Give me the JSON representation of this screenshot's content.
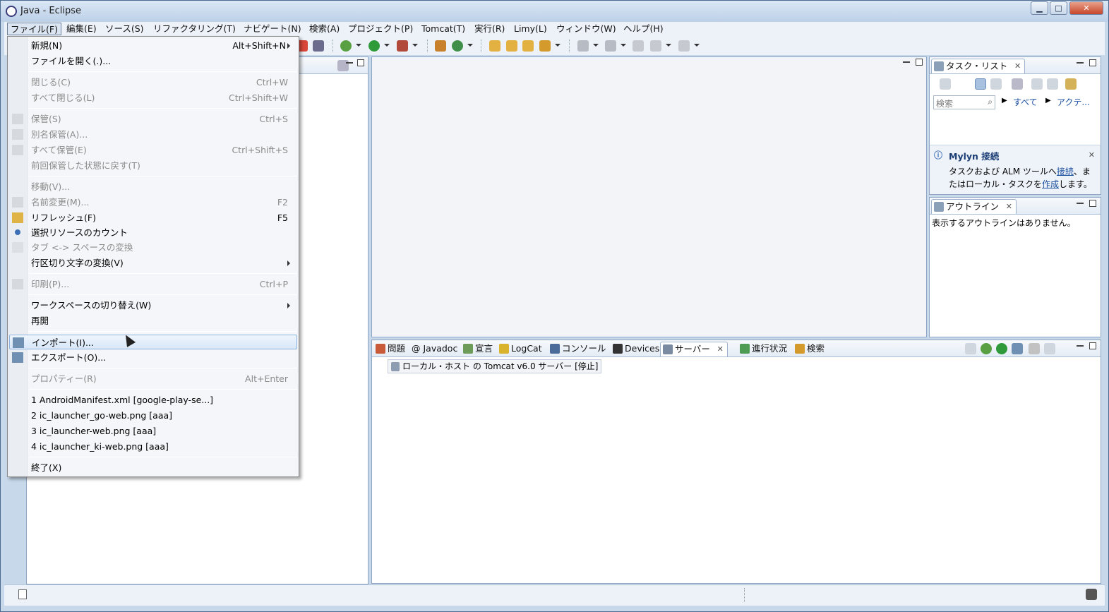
{
  "window": {
    "title": "Java - Eclipse",
    "controls": [
      "minimize",
      "maximize",
      "close"
    ]
  },
  "menubar": [
    "ファイル(F)",
    "編集(E)",
    "ソース(S)",
    "リファクタリング(T)",
    "ナビゲート(N)",
    "検索(A)",
    "プロジェクト(P)",
    "Tomcat(T)",
    "実行(R)",
    "Limy(L)",
    "ウィンドウ(W)",
    "ヘルプ(H)"
  ],
  "file_menu": {
    "items": [
      {
        "label": "新規(N)",
        "shortcut": "Alt+Shift+N",
        "submenu": true,
        "disabled": false
      },
      {
        "label": "ファイルを開く(.)...",
        "shortcut": "",
        "disabled": false
      },
      {
        "label": "閉じる(C)",
        "shortcut": "Ctrl+W",
        "disabled": true
      },
      {
        "label": "すべて閉じる(L)",
        "shortcut": "Ctrl+Shift+W",
        "disabled": true
      },
      {
        "label": "保管(S)",
        "shortcut": "Ctrl+S",
        "disabled": true
      },
      {
        "label": "別名保管(A)...",
        "shortcut": "",
        "disabled": true
      },
      {
        "label": "すべて保管(E)",
        "shortcut": "Ctrl+Shift+S",
        "disabled": true
      },
      {
        "label": "前回保管した状態に戻す(T)",
        "shortcut": "",
        "disabled": true
      },
      {
        "label": "移動(V)...",
        "shortcut": "",
        "disabled": true
      },
      {
        "label": "名前変更(M)...",
        "shortcut": "F2",
        "disabled": true
      },
      {
        "label": "リフレッシュ(F)",
        "shortcut": "F5",
        "disabled": false
      },
      {
        "label": "選択リソースのカウント",
        "shortcut": "",
        "disabled": false
      },
      {
        "label": "タブ <-> スペースの変換",
        "shortcut": "",
        "disabled": true
      },
      {
        "label": "行区切り文字の変換(V)",
        "shortcut": "",
        "submenu": true,
        "disabled": false
      },
      {
        "label": "印刷(P)...",
        "shortcut": "Ctrl+P",
        "disabled": true
      },
      {
        "label": "ワークスペースの切り替え(W)",
        "shortcut": "",
        "submenu": true,
        "disabled": false
      },
      {
        "label": "再開",
        "shortcut": "",
        "disabled": false
      },
      {
        "label": "インポート(I)...",
        "shortcut": "",
        "disabled": false,
        "highlighted": true
      },
      {
        "label": "エクスポート(O)...",
        "shortcut": "",
        "disabled": false
      },
      {
        "label": "プロパティー(R)",
        "shortcut": "Alt+Enter",
        "disabled": true
      },
      {
        "label": "1 AndroidManifest.xml  [google-play-se...]",
        "shortcut": "",
        "disabled": false
      },
      {
        "label": "2 ic_launcher_go-web.png  [aaa]",
        "shortcut": "",
        "disabled": false
      },
      {
        "label": "3 ic_launcher-web.png  [aaa]",
        "shortcut": "",
        "disabled": false
      },
      {
        "label": "4 ic_launcher_ki-web.png  [aaa]",
        "shortcut": "",
        "disabled": false
      },
      {
        "label": "終了(X)",
        "shortcut": "",
        "disabled": false
      }
    ]
  },
  "task_list": {
    "tab": "タスク・リスト",
    "search_placeholder": "検索",
    "filter_all": "すべて",
    "filter_active": "アクテ...",
    "mylyn_title": "Mylyn 接続",
    "mylyn_text_1": "タスクおよび ALM ツールへ",
    "mylyn_link_connect": "接続",
    "mylyn_text_2": "、ま",
    "mylyn_text_3": "たはローカル・タスクを",
    "mylyn_link_create": "作成",
    "mylyn_text_4": "します。"
  },
  "outline": {
    "tab": "アウトライン",
    "empty_message": "表示するアウトラインはありません。"
  },
  "bottom_tabs": [
    "問題",
    "@ Javadoc",
    "宣言",
    "LogCat",
    "コンソール",
    "Devices",
    "サーバー",
    "進行状況",
    "検索"
  ],
  "servers": {
    "entry": "ローカル・ホスト の Tomcat v6.0 サーバー  [停止]"
  },
  "colors": {
    "accent": "#3d6fb6",
    "frame": "#c7d8ea",
    "link": "#1a4fa0"
  }
}
